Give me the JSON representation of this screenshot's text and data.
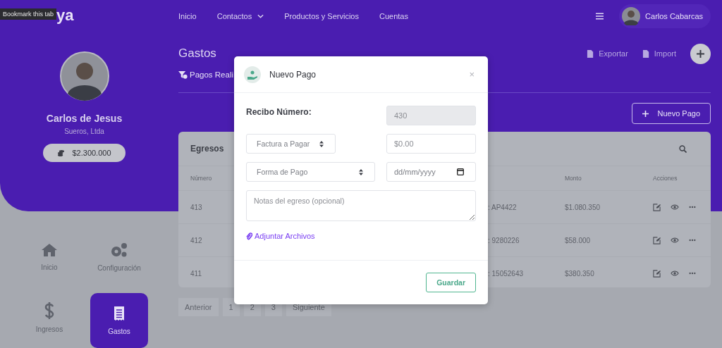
{
  "tooltip": "Bookmark this tab",
  "logo": "ya",
  "nav": {
    "links": [
      {
        "label": "Inicio",
        "dropdown": false
      },
      {
        "label": "Contactos",
        "dropdown": true
      },
      {
        "label": "Productos y Servicios",
        "dropdown": false
      },
      {
        "label": "Cuentas",
        "dropdown": false
      }
    ],
    "user": "Carlos Cabarcas"
  },
  "profile": {
    "name": "Carlos de Jesus",
    "company": "Sueros, Ltda",
    "balance": "$2.300.000"
  },
  "sidebar_nav": [
    {
      "kind": "home",
      "label": "Inicio",
      "selected": false
    },
    {
      "kind": "settings",
      "label": "Configuración",
      "selected": false
    },
    {
      "kind": "income",
      "label": "Ingresos",
      "selected": false
    },
    {
      "kind": "expenses",
      "label": "Gastos",
      "selected": true
    }
  ],
  "page": {
    "title": "Gastos",
    "tab": "Pagos Reali",
    "actions": [
      "Exportar",
      "Import"
    ],
    "new_button": "Nuevo Pago"
  },
  "table": {
    "title": "Egresos",
    "columns": [
      "Número",
      "",
      "Monto",
      "Acciones"
    ],
    "rows": [
      {
        "number": "413",
        "column_2": ": AP4422",
        "amount": "$1.080.350"
      },
      {
        "number": "412",
        "column_2": ": 9280226",
        "amount": "$58.000"
      },
      {
        "number": "411",
        "column_2": ": 15052643",
        "amount": "$380.350"
      }
    ]
  },
  "pagination": [
    {
      "label": "Anterior"
    },
    {
      "label": "1"
    },
    {
      "label": "2"
    },
    {
      "label": "3"
    },
    {
      "label": "Siguiente"
    }
  ],
  "modal": {
    "title": "Nuevo Pago",
    "close": "×",
    "receipt": {
      "label": "Recibo Número:",
      "value": "430",
      "disabled": true
    },
    "invoice_select": {
      "value": "Factura a Pagar"
    },
    "amount": {
      "placeholder": "$0.00"
    },
    "payment_method_select": {
      "value": "Forma de Pago"
    },
    "date": {
      "placeholder": "dd/mm/yyyy"
    },
    "notes": {
      "placeholder": "Notas del egreso (opcional)"
    },
    "attach_link": "Adjuntar Archivos",
    "save_button": "Guardar"
  }
}
